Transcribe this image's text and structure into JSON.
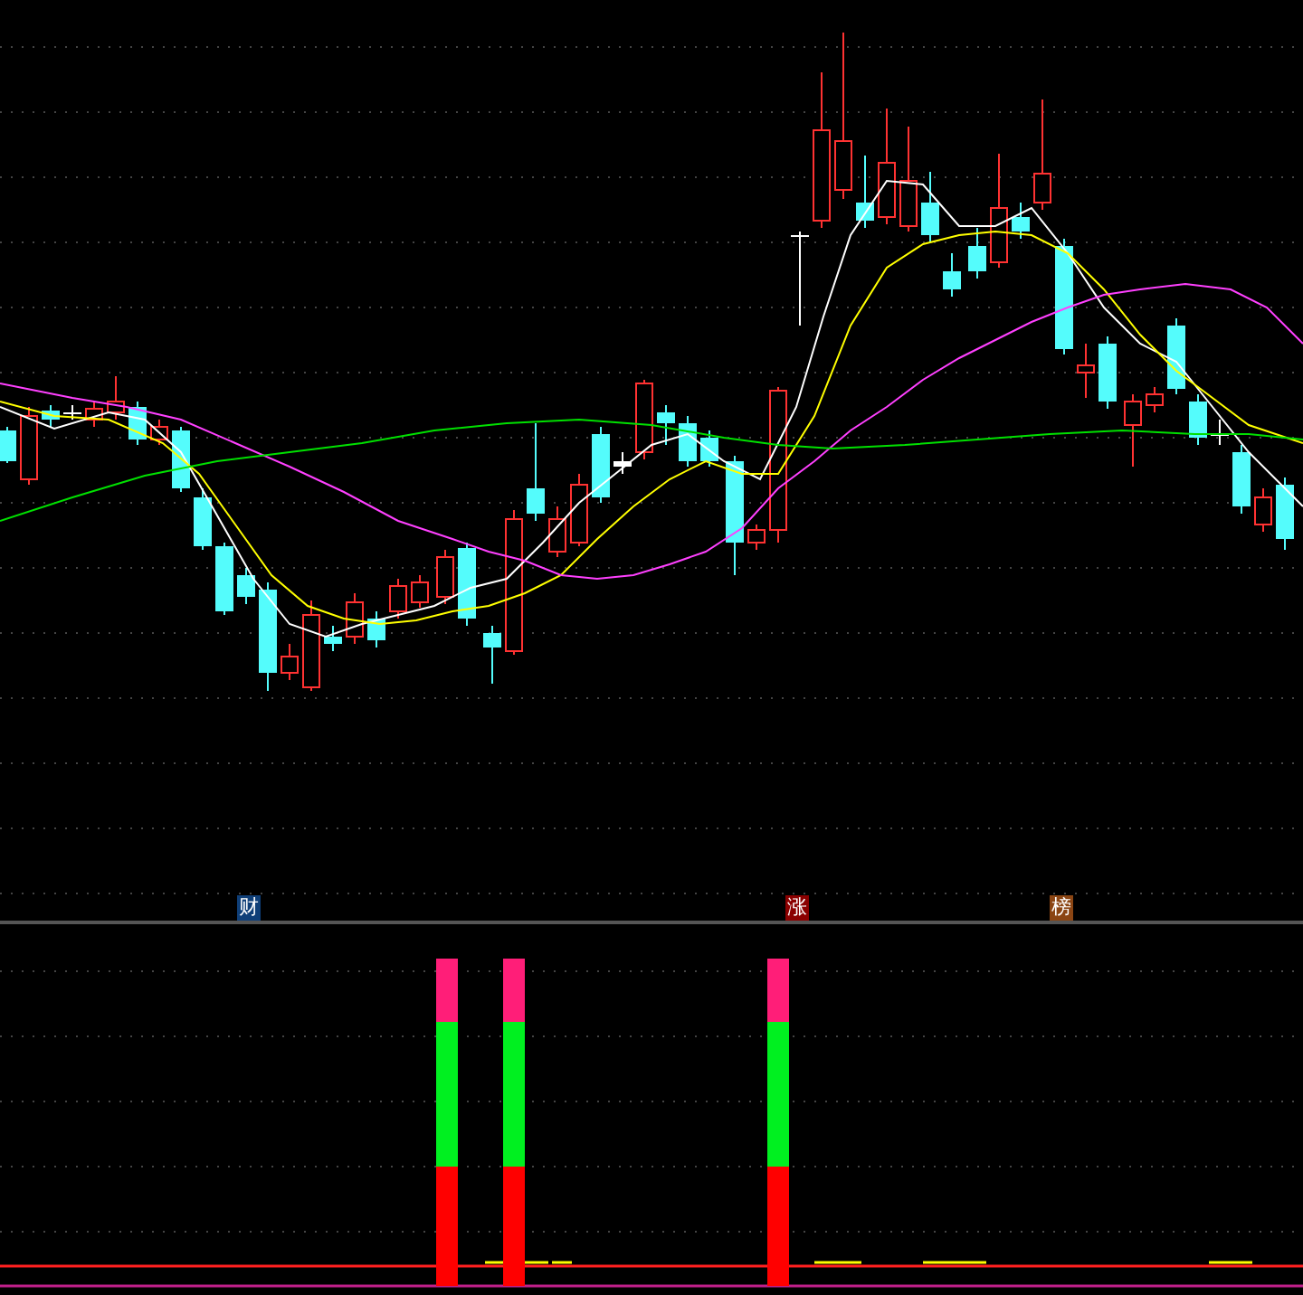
{
  "event_markers": [
    {
      "label": "财",
      "color": "#0f3f78"
    },
    {
      "label": "涨",
      "color": "#8b0000"
    },
    {
      "label": "榜",
      "color": "#8b4513"
    }
  ]
}
